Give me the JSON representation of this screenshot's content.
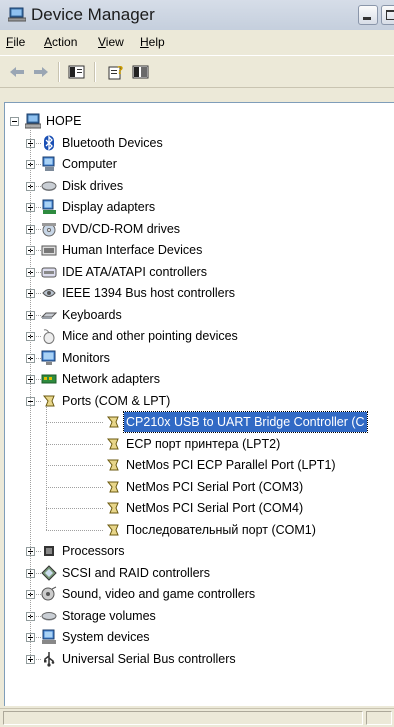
{
  "window": {
    "title": "Device Manager",
    "controls": [
      "minimize-icon",
      "maximize-icon"
    ]
  },
  "menu": [
    {
      "label": "File",
      "u": "F",
      "rest": "ile"
    },
    {
      "label": "Action",
      "u": "A",
      "rest": "ction"
    },
    {
      "label": "View",
      "u": "V",
      "rest": "iew"
    },
    {
      "label": "Help",
      "u": "H",
      "rest": "elp"
    }
  ],
  "toolbar": [
    "back-arrow-icon",
    "forward-arrow-icon",
    "show-hide-console-tree-icon",
    "properties-icon",
    "help-icon"
  ],
  "tree": {
    "root": "HOPE",
    "categories": [
      {
        "label": "Bluetooth Devices",
        "icon": "bluetooth-icon"
      },
      {
        "label": "Computer",
        "icon": "computer-icon"
      },
      {
        "label": "Disk drives",
        "icon": "disk-drive-icon"
      },
      {
        "label": "Display adapters",
        "icon": "display-adapter-icon"
      },
      {
        "label": "DVD/CD-ROM drives",
        "icon": "cdrom-icon"
      },
      {
        "label": "Human Interface Devices",
        "icon": "hid-icon"
      },
      {
        "label": "IDE ATA/ATAPI controllers",
        "icon": "ide-controller-icon"
      },
      {
        "label": "IEEE 1394 Bus host controllers",
        "icon": "ieee1394-icon"
      },
      {
        "label": "Keyboards",
        "icon": "keyboard-icon"
      },
      {
        "label": "Mice and other pointing devices",
        "icon": "mouse-icon"
      },
      {
        "label": "Monitors",
        "icon": "monitor-icon"
      },
      {
        "label": "Network adapters",
        "icon": "network-adapter-icon"
      },
      {
        "label": "Ports (COM & LPT)",
        "icon": "port-icon",
        "expanded": true,
        "children": [
          {
            "label": "CP210x USB to UART Bridge Controller (C",
            "selected": true
          },
          {
            "label": "ECP порт принтера (LPT2)"
          },
          {
            "label": "NetMos PCI ECP Parallel Port (LPT1)"
          },
          {
            "label": "NetMos PCI Serial Port (COM3)"
          },
          {
            "label": "NetMos PCI Serial Port (COM4)"
          },
          {
            "label": "Последовательный порт (COM1)"
          }
        ]
      },
      {
        "label": "Processors",
        "icon": "processor-icon"
      },
      {
        "label": "SCSI and RAID controllers",
        "icon": "scsi-icon"
      },
      {
        "label": "Sound, video and game controllers",
        "icon": "sound-icon"
      },
      {
        "label": "Storage volumes",
        "icon": "storage-volume-icon"
      },
      {
        "label": "System devices",
        "icon": "system-devices-icon"
      },
      {
        "label": "Universal Serial Bus controllers",
        "icon": "usb-icon"
      }
    ]
  },
  "colors": {
    "selection": "#316ac5",
    "tree_background": "#ffffff",
    "chrome": "#ece9d8"
  }
}
